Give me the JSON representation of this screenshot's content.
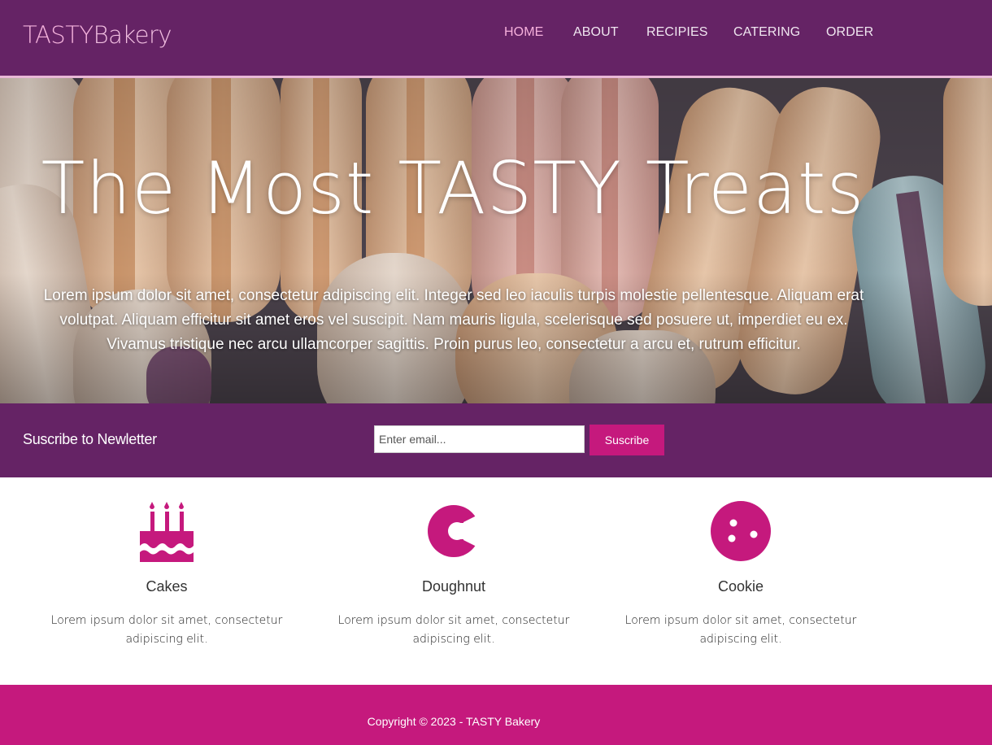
{
  "header": {
    "logo_bold": "TASTY",
    "logo_rest": "Bakery",
    "nav": [
      {
        "label": "HOME",
        "active": true
      },
      {
        "label": "ABOUT",
        "active": false
      },
      {
        "label": "RECIPIES",
        "active": false
      },
      {
        "label": "CATERING",
        "active": false
      },
      {
        "label": "ORDER",
        "active": false
      }
    ]
  },
  "hero": {
    "title": "The Most TASTY Treats",
    "text": "Lorem ipsum dolor sit amet, consectetur adipiscing elit. Integer sed leo iaculis turpis molestie pellentesque. Aliquam erat volutpat. Aliquam efficitur sit amet eros vel suscipit. Nam mauris ligula, scelerisque sed posuere ut, imperdiet eu ex. Vivamus tristique nec arcu ullamcorper sagittis. Proin purus leo, consectetur a arcu et, rutrum efficitur."
  },
  "newsletter": {
    "label": "Suscribe to Newletter",
    "placeholder": "Enter email...",
    "button_label": "Suscribe"
  },
  "features": [
    {
      "title": "Cakes",
      "text": "Lorem ipsum dolor sit amet, consectetur adipiscing elit.",
      "icon": "cake-icon"
    },
    {
      "title": "Doughnut",
      "text": "Lorem ipsum dolor sit amet, consectetur adipiscing elit.",
      "icon": "doughnut-icon"
    },
    {
      "title": "Cookie",
      "text": "Lorem ipsum dolor sit amet, consectetur adipiscing elit.",
      "icon": "cookie-icon"
    }
  ],
  "footer": {
    "copyright": "Copyright © 2023 - TASTY Bakery"
  },
  "colors": {
    "header_bg": "#652365",
    "accent": "#c5197d",
    "logo": "#f2bfe1"
  }
}
